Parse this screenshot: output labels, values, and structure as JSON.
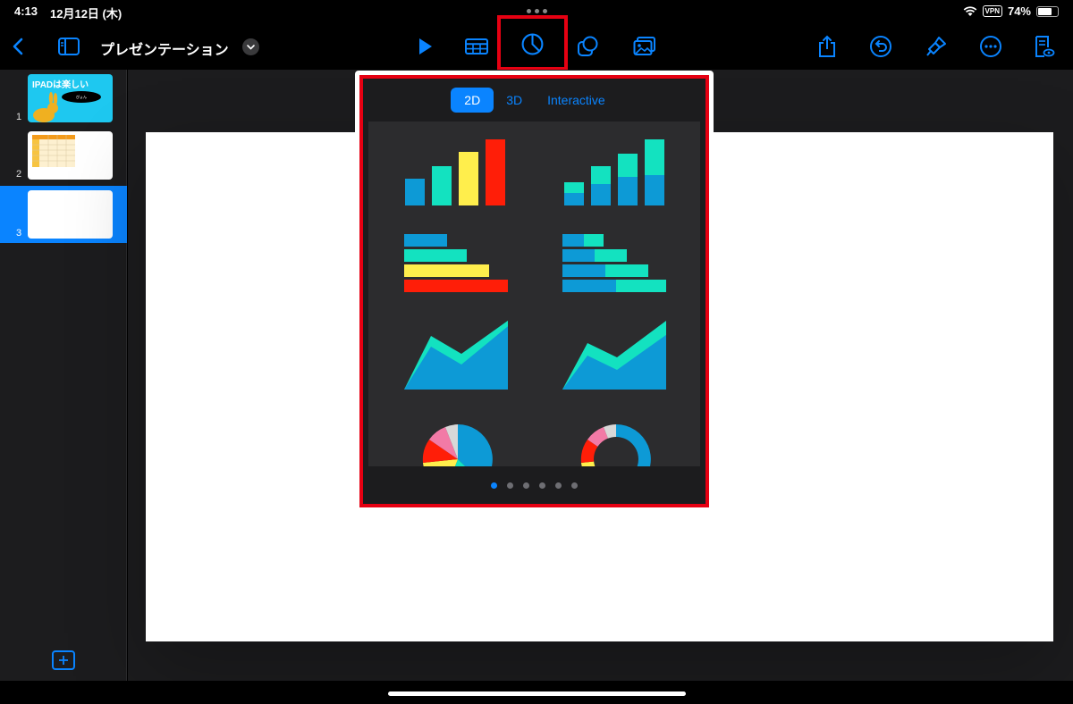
{
  "status": {
    "time": "4:13",
    "date": "12月12日 (木)",
    "vpn": "VPN",
    "battery": "74%",
    "battery_fraction": 0.74
  },
  "toolbar": {
    "title": "プレゼンテーション"
  },
  "slides": [
    {
      "number": "1",
      "title": "IPADは楽しい",
      "bubble": "ぴょん"
    },
    {
      "number": "2"
    },
    {
      "number": "3"
    }
  ],
  "chart_picker": {
    "tabs": [
      "2D",
      "3D",
      "Interactive"
    ],
    "active_tab": "2D",
    "chart_types": [
      "column",
      "stacked-column",
      "bar",
      "stacked-bar",
      "area",
      "stacked-area",
      "pie",
      "donut"
    ],
    "page_count": 6,
    "current_page": 1
  },
  "colors": {
    "accent": "#0a84ff",
    "highlight": "#e60012",
    "chart_blue": "#0d9ad6",
    "chart_teal": "#13e2c0",
    "chart_yellow": "#ffee4c",
    "chart_red": "#ff1e08"
  }
}
